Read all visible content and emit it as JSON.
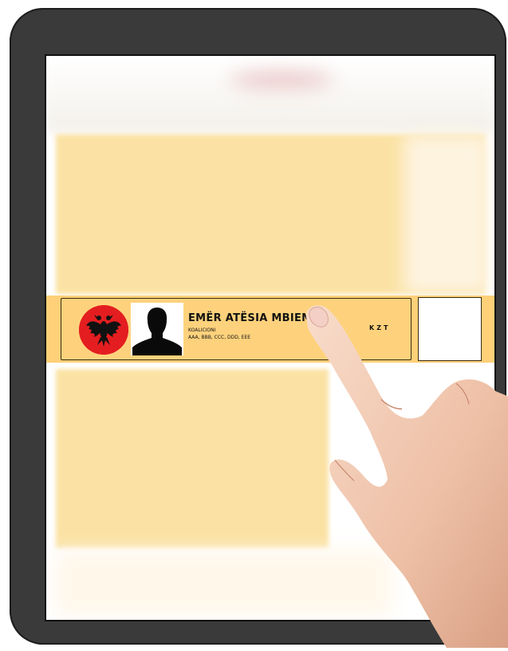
{
  "candidate": {
    "name": "EMËR ATËSIA MBIEMËR",
    "coalition_label": "KOALICIONI",
    "parties": "AAA, BBB, CCC, DDD, EEE",
    "code": "KZT",
    "emblem_icon": "albanian-eagle-icon",
    "photo_icon": "person-silhouette-icon",
    "emblem_color": "#e41e20",
    "row_color": "#fed078"
  },
  "background": {
    "panel_color": "#fbe2a4"
  },
  "overlay": {
    "icon": "pointing-hand-icon"
  }
}
